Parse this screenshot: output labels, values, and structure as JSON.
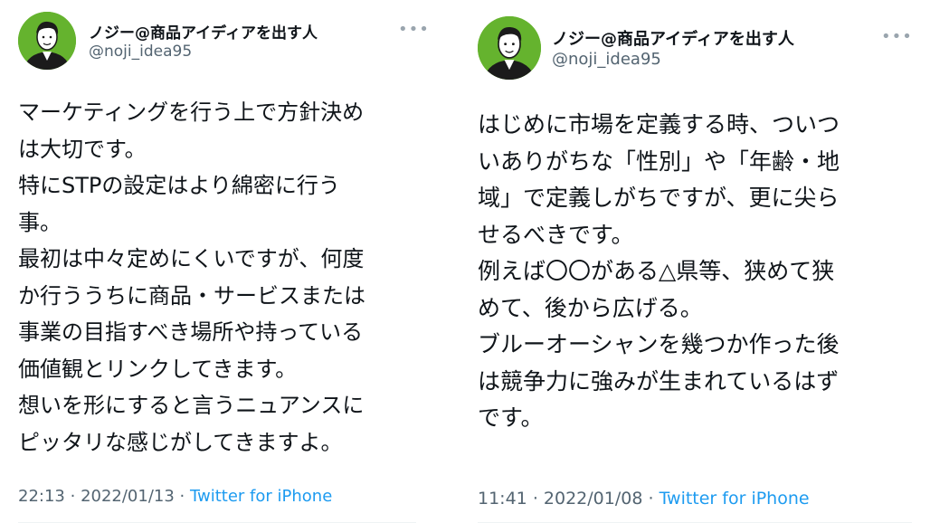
{
  "tweets": [
    {
      "author_name": "ノジー@商品アイディアを出す人",
      "author_handle": "@noji_idea95",
      "more_label": "•••",
      "lines": [
        "マーケティングを行う上で方針決め",
        "は大切です。",
        "特にSTPの設定はより綿密に行う",
        "事。",
        "最初は中々定めにくいですが、何度",
        "か行ううちに商品・サービスまたは",
        "事業の目指すべき場所や持っている",
        "価値観とリンクしてきます。",
        "想いを形にすると言うニュアンスに",
        "ピッタリな感じがしてきますよ。"
      ],
      "time": "22:13",
      "date": "2022/01/13",
      "separator": " · ",
      "source": "Twitter for iPhone"
    },
    {
      "author_name": "ノジー@商品アイディアを出す人",
      "author_handle": "@noji_idea95",
      "more_label": "•••",
      "lines": [
        "はじめに市場を定義する時、ついつ",
        "いありがちな「性別」や「年齢・地",
        "域」で定義しがちですが、更に尖ら",
        "せるべきです。",
        "例えば〇〇がある△県等、狭めて狭",
        "めて、後から広げる。",
        "ブルーオーシャンを幾つか作った後",
        "は競争力に強みが生まれているはず",
        "です。"
      ],
      "time": "11:41",
      "date": "2022/01/08",
      "separator": " · ",
      "source": "Twitter for iPhone"
    }
  ]
}
